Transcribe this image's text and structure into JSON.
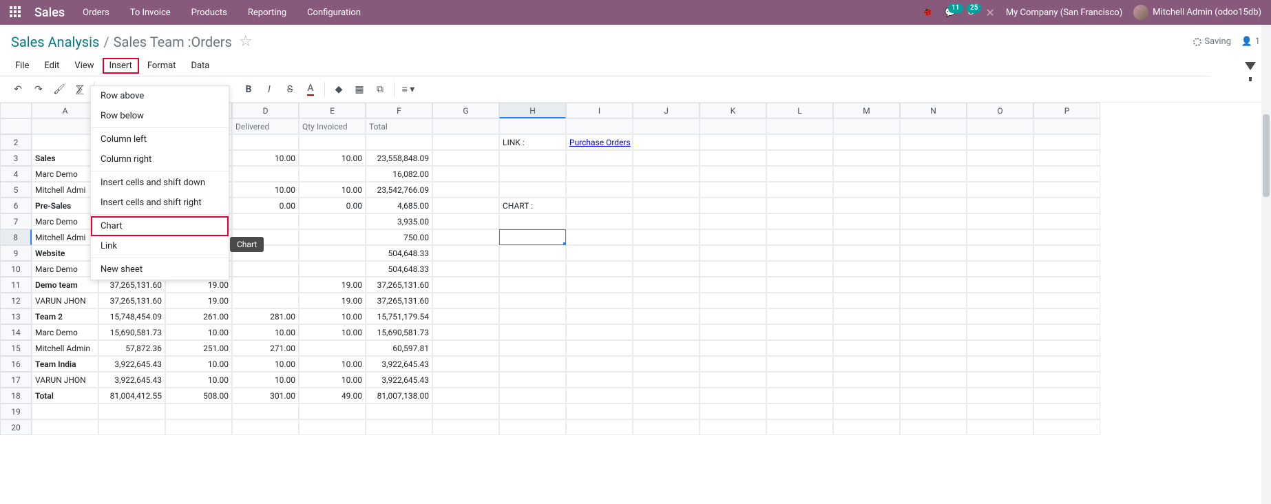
{
  "topbar": {
    "brand": "Sales",
    "menu": [
      "Orders",
      "To Invoice",
      "Products",
      "Reporting",
      "Configuration"
    ],
    "msg_count": "11",
    "activity_count": "25",
    "company": "My Company (San Francisco)",
    "user": "Mitchell Admin (odoo15db)"
  },
  "breadcrumb": {
    "p1": "Sales Analysis",
    "p2": "Sales Team :Orders",
    "saving": "Saving",
    "user_count": "1"
  },
  "menubar": [
    "File",
    "Edit",
    "View",
    "Insert",
    "Format",
    "Data"
  ],
  "insert_menu": {
    "row_above": "Row above",
    "row_below": "Row below",
    "col_left": "Column left",
    "col_right": "Column right",
    "cells_down": "Insert cells and shift down",
    "cells_right": "Insert cells and shift right",
    "chart": "Chart",
    "link": "Link",
    "new_sheet": "New sheet"
  },
  "tooltip": "Chart",
  "columns": [
    "A",
    "B",
    "C",
    "D",
    "E",
    "F",
    "G",
    "H",
    "I",
    "J",
    "K",
    "L",
    "M",
    "N",
    "O",
    "P"
  ],
  "header_row": {
    "D": "Delivered",
    "E": "Qty Invoiced",
    "F": "Total"
  },
  "rows": [
    {
      "n": 2,
      "H": "LINK :",
      "I": "Purchase Orders",
      "I_link": true
    },
    {
      "n": 3,
      "A": "Sales",
      "A_bold": true,
      "D": "10.00",
      "E": "10.00",
      "F": "23,558,848.09"
    },
    {
      "n": 4,
      "A": "Marc Demo",
      "F": "16,082.00"
    },
    {
      "n": 5,
      "A": "Mitchell Admi",
      "D": "10.00",
      "E": "10.00",
      "F": "23,542,766.09"
    },
    {
      "n": 6,
      "A": "Pre-Sales",
      "A_bold": true,
      "D": "0.00",
      "E": "0.00",
      "F": "4,685.00",
      "H": "CHART :"
    },
    {
      "n": 7,
      "A": "Marc Demo",
      "F": "3,935.00"
    },
    {
      "n": 8,
      "A": "Mitchell Admi",
      "F": "750.00",
      "H_selected": true
    },
    {
      "n": 9,
      "A": "Website",
      "A_bold": true,
      "F": "504,648.33"
    },
    {
      "n": 10,
      "A": "Marc Demo",
      "F": "504,648.33"
    },
    {
      "n": 11,
      "A": "Demo team",
      "A_bold": true,
      "B": "37,265,131.60",
      "C": "19.00",
      "E": "19.00",
      "F": "37,265,131.60"
    },
    {
      "n": 12,
      "A": "VARUN JHON",
      "B": "37,265,131.60",
      "C": "19.00",
      "E": "19.00",
      "F": "37,265,131.60"
    },
    {
      "n": 13,
      "A": "Team 2",
      "A_bold": true,
      "B": "15,748,454.09",
      "C": "261.00",
      "D": "281.00",
      "E": "10.00",
      "F": "15,751,179.54"
    },
    {
      "n": 14,
      "A": "Marc Demo",
      "B": "15,690,581.73",
      "C": "10.00",
      "D": "10.00",
      "E": "10.00",
      "F": "15,690,581.73"
    },
    {
      "n": 15,
      "A": "Mitchell Admin",
      "B": "57,872.36",
      "C": "251.00",
      "D": "271.00",
      "F": "60,597.81"
    },
    {
      "n": 16,
      "A": "Team India",
      "A_bold": true,
      "B": "3,922,645.43",
      "C": "10.00",
      "D": "10.00",
      "E": "10.00",
      "F": "3,922,645.43"
    },
    {
      "n": 17,
      "A": "VARUN JHON",
      "B": "3,922,645.43",
      "C": "10.00",
      "D": "10.00",
      "E": "10.00",
      "F": "3,922,645.43"
    },
    {
      "n": 18,
      "A": "Total",
      "A_bold": true,
      "B": "81,004,412.55",
      "C": "508.00",
      "D": "301.00",
      "E": "49.00",
      "F": "81,007,138.00"
    },
    {
      "n": 19
    },
    {
      "n": 20
    }
  ]
}
